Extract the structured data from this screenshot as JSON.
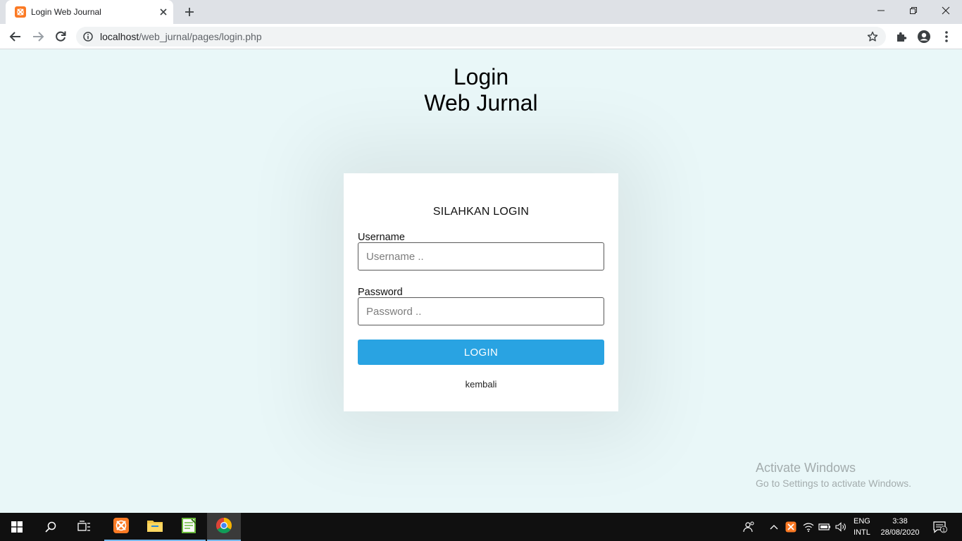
{
  "browser": {
    "tab_title": "Login Web Journal",
    "url_host": "localhost",
    "url_path": "/web_jurnal/pages/login.php"
  },
  "page": {
    "title_line1": "Login",
    "title_line2": "Web Jurnal",
    "card_heading": "SILAHKAN LOGIN",
    "username_label": "Username",
    "username_placeholder": "Username ..",
    "password_label": "Password",
    "password_placeholder": "Password ..",
    "login_button": "LOGIN",
    "back_link": "kembali"
  },
  "watermark": {
    "title": "Activate Windows",
    "subtitle": "Go to Settings to activate Windows."
  },
  "taskbar": {
    "lang_line1": "ENG",
    "lang_line2": "INTL",
    "time": "3:38",
    "date": "28/08/2020",
    "notification_count": "1"
  },
  "colors": {
    "page_background": "#e9f7f8",
    "login_button": "#29a3e2",
    "xampp_orange": "#fb7a24",
    "taskbar": "#101010"
  },
  "icons": [
    "xampp-icon",
    "close-icon",
    "plus-icon",
    "minimize-icon",
    "restore-icon",
    "back-arrow-icon",
    "forward-arrow-icon",
    "reload-icon",
    "info-icon",
    "star-icon",
    "extensions-icon",
    "profile-icon",
    "menu-dots-icon",
    "windows-start-icon",
    "search-icon",
    "task-view-icon",
    "folder-icon",
    "notepad-icon",
    "chrome-icon",
    "people-icon",
    "chevron-up-icon",
    "wifi-icon",
    "battery-icon",
    "volume-icon",
    "notification-icon"
  ]
}
